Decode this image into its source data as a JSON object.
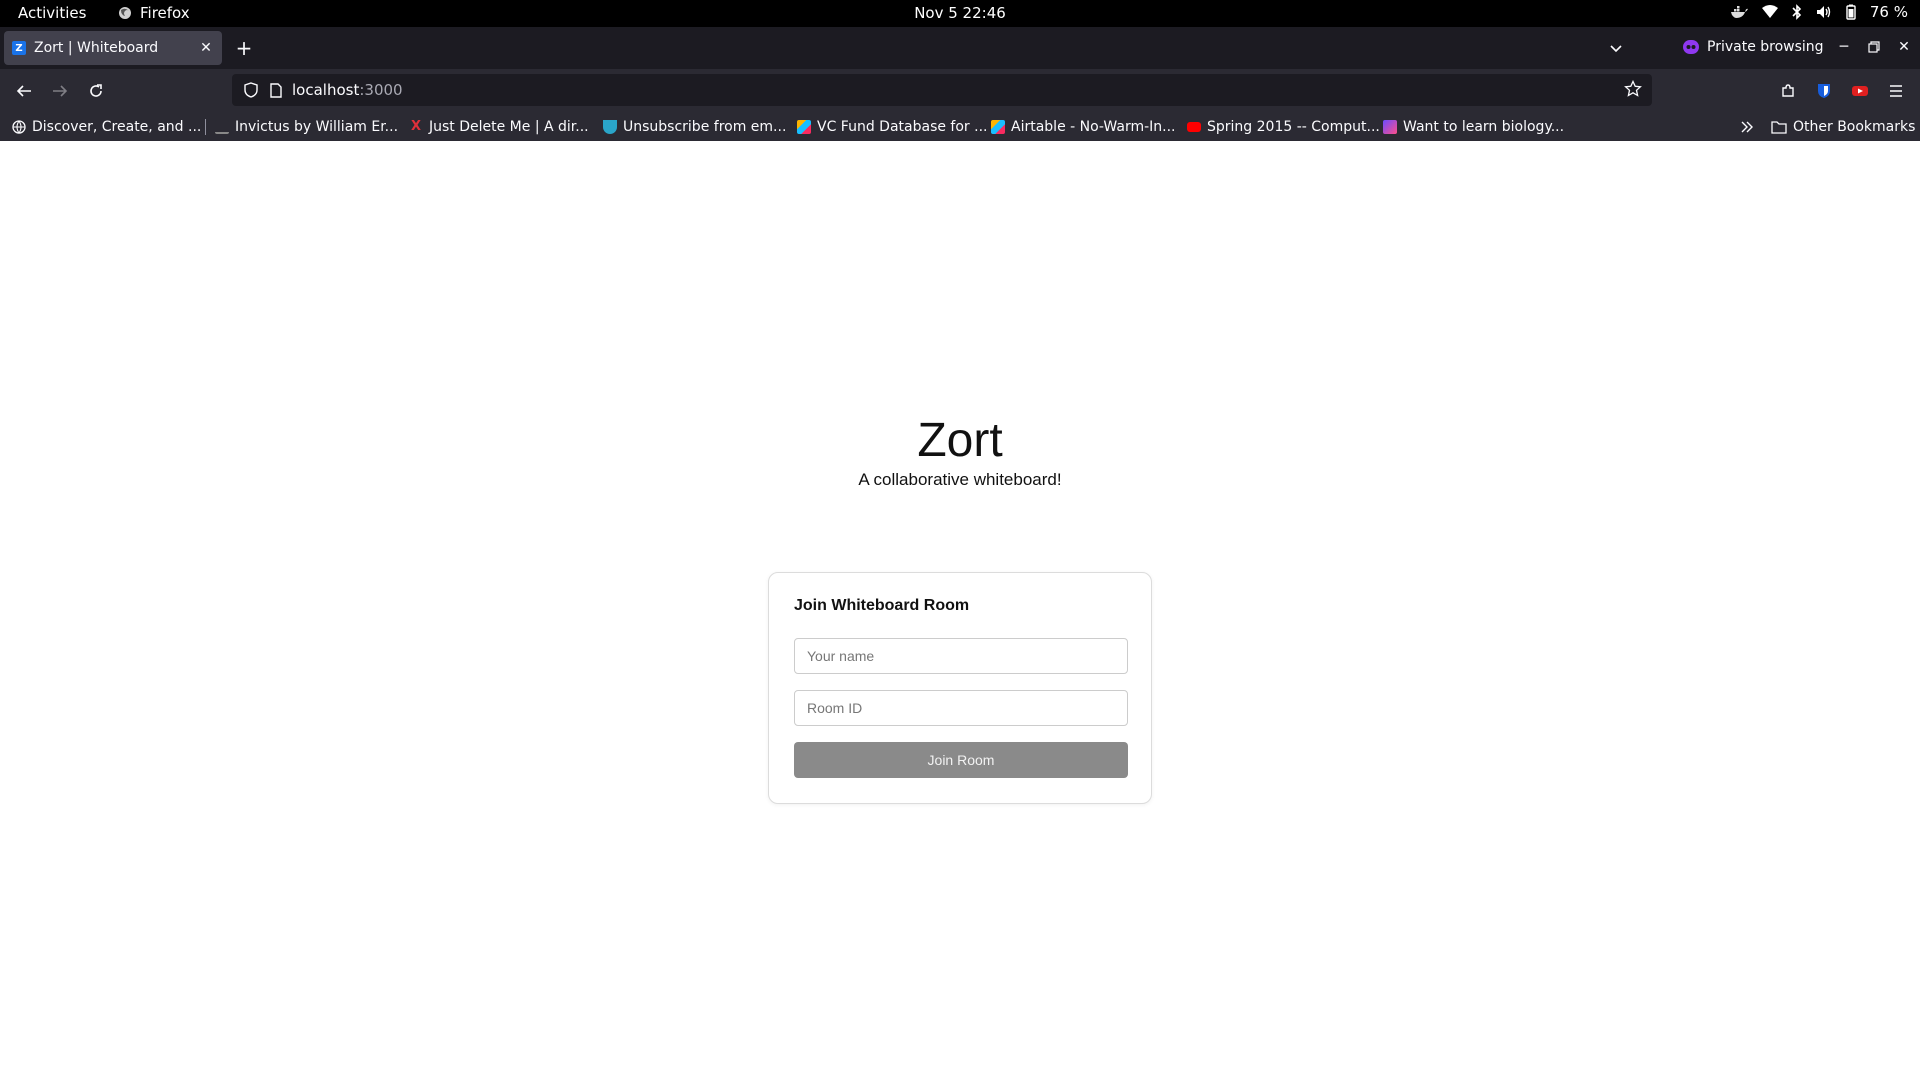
{
  "system": {
    "activities": "Activities",
    "app_name": "Firefox",
    "clock": "Nov 5  22:46",
    "battery": "76 %"
  },
  "browser": {
    "tab_title": "Zort | Whiteboard",
    "tab_favicon": "Z",
    "private_label": "Private browsing",
    "url_host": "localhost",
    "url_port": ":3000",
    "bookmarks": [
      {
        "label": "Discover, Create, and ...",
        "color": "#fbfbfe"
      },
      {
        "label": "Invictus by William Er...",
        "color": "#222222"
      },
      {
        "label": "Just Delete Me | A dir...",
        "color": "#e0303a"
      },
      {
        "label": "Unsubscribe from em...",
        "color": "#2aa5c9"
      },
      {
        "label": "VC Fund Database for ...",
        "color": "#f0a020"
      },
      {
        "label": "Airtable - No-Warm-In...",
        "color": "#18bfff"
      },
      {
        "label": "Spring 2015 -- Comput...",
        "color": "#ff0000"
      },
      {
        "label": "Want to learn biology...",
        "color": "#6a4cff"
      }
    ],
    "other_bookmarks": "Other Bookmarks"
  },
  "page": {
    "title": "Zort",
    "subtitle": "A collaborative whiteboard!",
    "card": {
      "heading": "Join Whiteboard Room",
      "name_placeholder": "Your name",
      "name_value": "",
      "room_placeholder": "Room ID",
      "room_value": "",
      "join_label": "Join Room"
    }
  },
  "colors": {
    "accent_private": "#8f38f0",
    "button_disabled": "#8a8a8a"
  }
}
